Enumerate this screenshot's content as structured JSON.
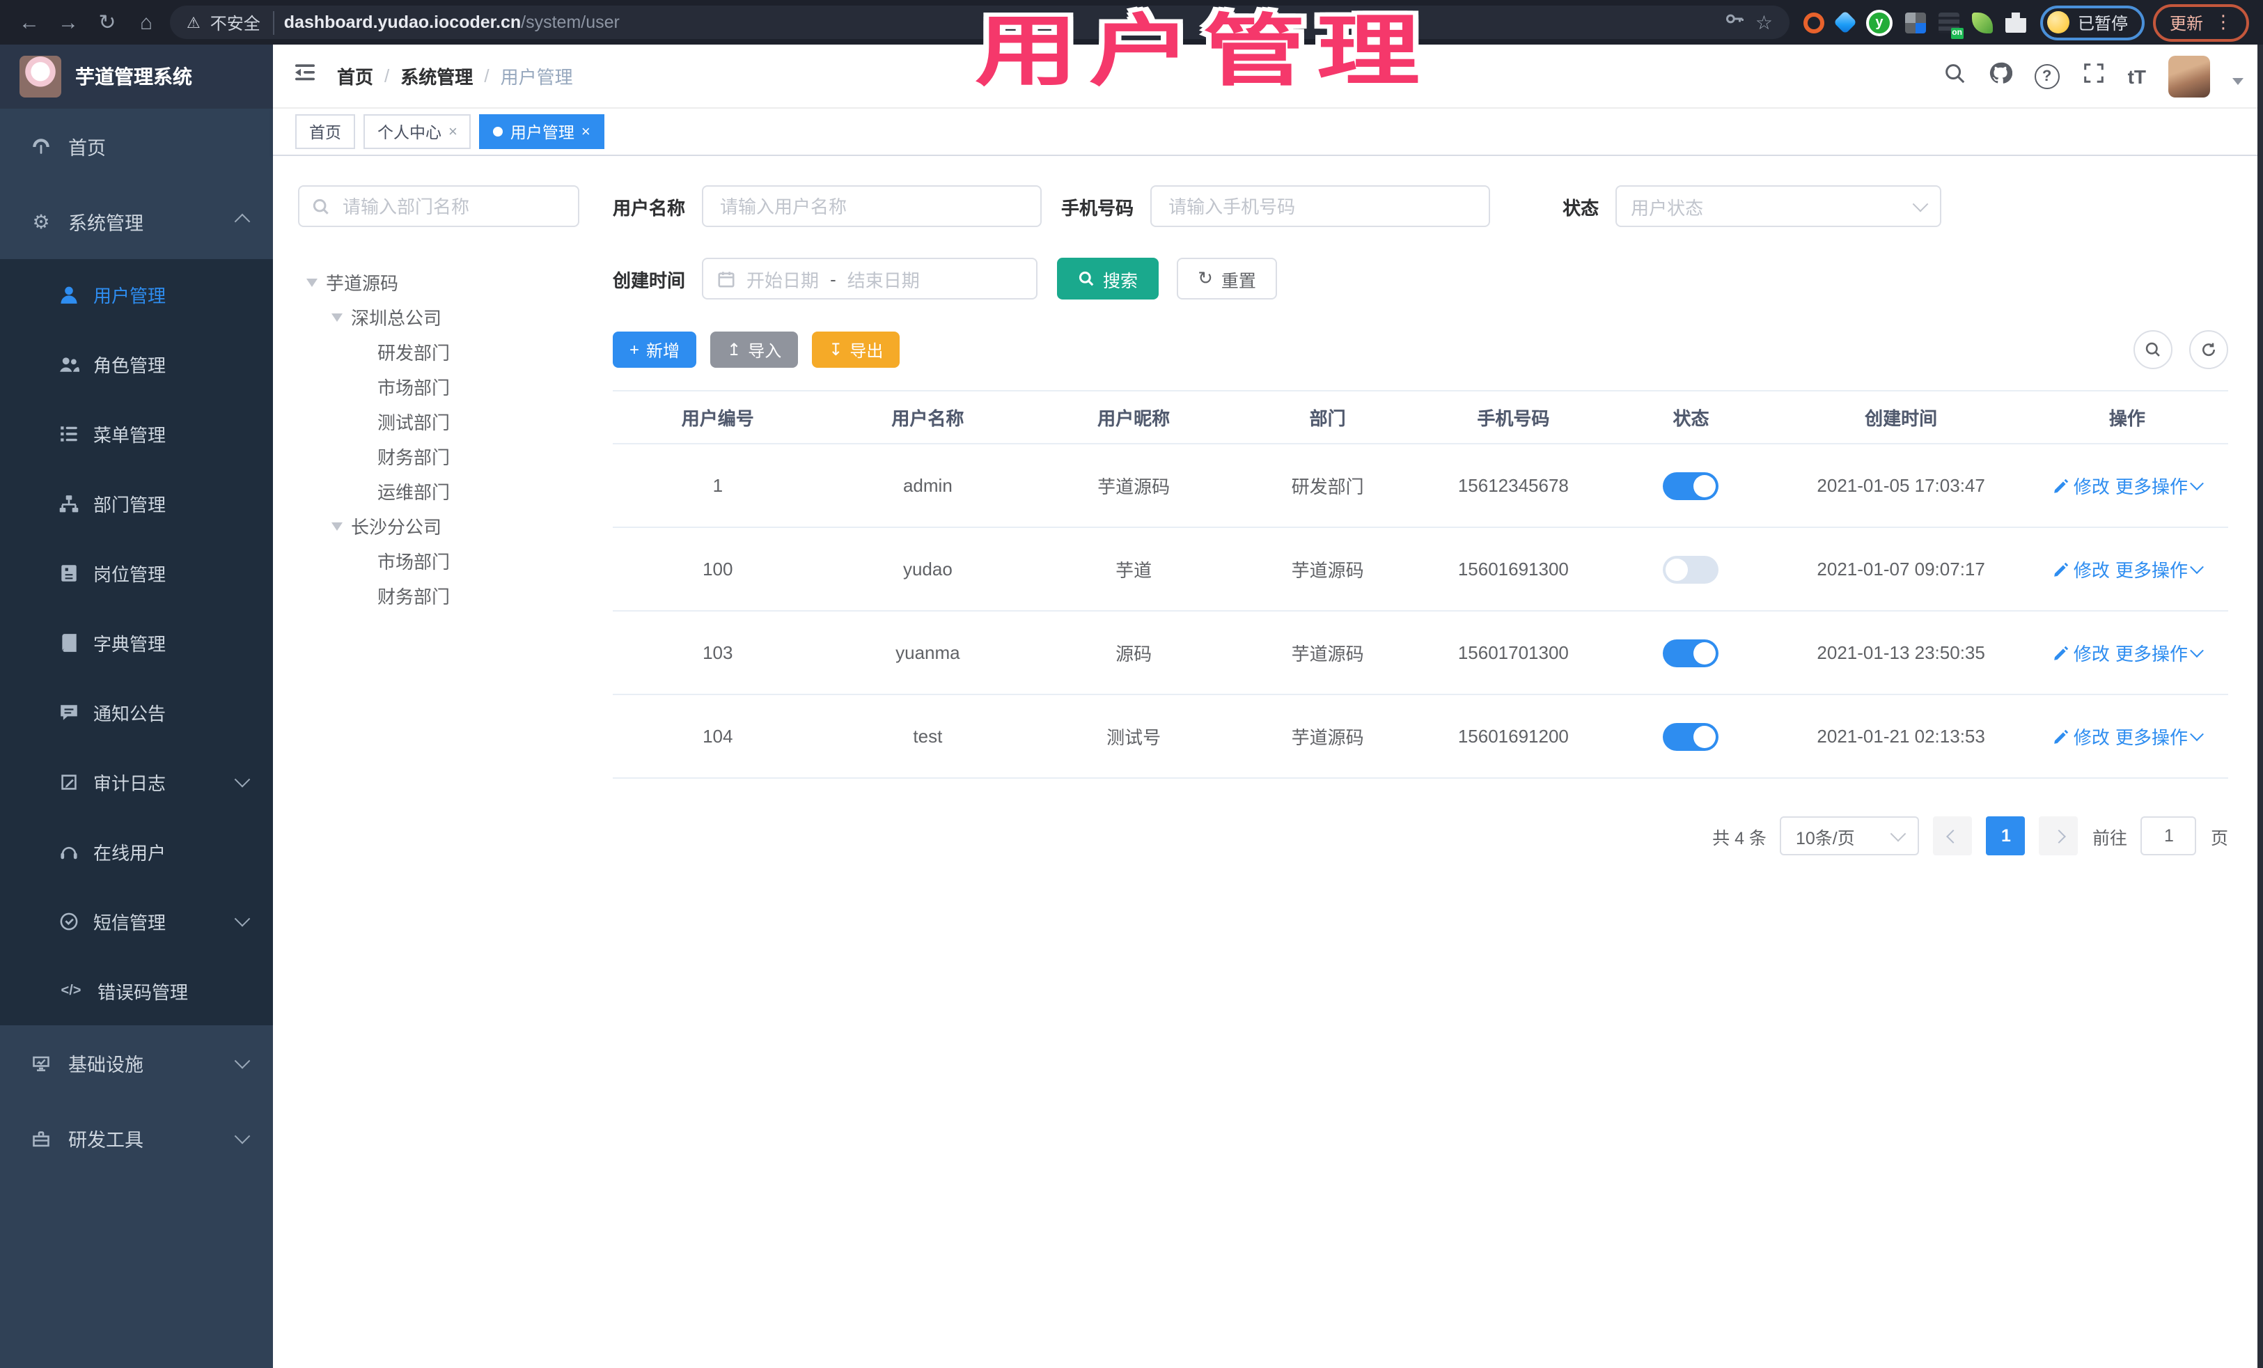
{
  "browser": {
    "security": "不安全",
    "url_host": "dashboard.yudao.iocoder.cn",
    "url_path": "/system/user",
    "paused_badge": "已暂停",
    "update_label": "更新"
  },
  "overlay_title": "用户管理",
  "icons": {
    "back": "←",
    "forward": "→",
    "reload": "↻",
    "home": "⌂",
    "warning": "⚠",
    "star": "☆",
    "kebab": "⋮",
    "gear": "⚙",
    "close": "×",
    "plus": "+",
    "upload": "↥",
    "download": "↧",
    "question": "?",
    "font_size": "tT",
    "code": "</>",
    "reset": "↻"
  },
  "app": {
    "logo_title": "芋道管理系统",
    "breadcrumb": [
      "首页",
      "系统管理",
      "用户管理"
    ],
    "breadcrumb_sep": "/",
    "tabs": [
      {
        "label": "首页"
      },
      {
        "label": "个人中心"
      },
      {
        "label": "用户管理"
      }
    ]
  },
  "sidebar": {
    "items": [
      {
        "label": "首页"
      },
      {
        "label": "系统管理"
      },
      {
        "label": "用户管理"
      },
      {
        "label": "角色管理"
      },
      {
        "label": "菜单管理"
      },
      {
        "label": "部门管理"
      },
      {
        "label": "岗位管理"
      },
      {
        "label": "字典管理"
      },
      {
        "label": "通知公告"
      },
      {
        "label": "审计日志"
      },
      {
        "label": "在线用户"
      },
      {
        "label": "短信管理"
      },
      {
        "label": "错误码管理"
      },
      {
        "label": "基础设施"
      },
      {
        "label": "研发工具"
      }
    ]
  },
  "tree": {
    "search_placeholder": "请输入部门名称",
    "nodes": [
      {
        "label": "芋道源码"
      },
      {
        "label": "深圳总公司"
      },
      {
        "label": "研发部门"
      },
      {
        "label": "市场部门"
      },
      {
        "label": "测试部门"
      },
      {
        "label": "财务部门"
      },
      {
        "label": "运维部门"
      },
      {
        "label": "长沙分公司"
      },
      {
        "label": "市场部门"
      },
      {
        "label": "财务部门"
      }
    ]
  },
  "filters": {
    "username_label": "用户名称",
    "username_placeholder": "请输入用户名称",
    "mobile_label": "手机号码",
    "mobile_placeholder": "请输入手机号码",
    "status_label": "状态",
    "status_placeholder": "用户状态",
    "created_label": "创建时间",
    "date_start_placeholder": "开始日期",
    "date_separator": "-",
    "date_end_placeholder": "结束日期",
    "search_label": "搜索",
    "reset_label": "重置"
  },
  "toolbar": {
    "add_label": "新增",
    "import_label": "导入",
    "export_label": "导出"
  },
  "table": {
    "headers": [
      "用户编号",
      "用户名称",
      "用户昵称",
      "部门",
      "手机号码",
      "状态",
      "创建时间",
      "操作"
    ],
    "edit_label": "修改",
    "more_label": "更多操作",
    "rows": [
      {
        "id": "1",
        "username": "admin",
        "nickname": "芋道源码",
        "dept": "研发部门",
        "mobile": "15612345678",
        "status": true,
        "created": "2021-01-05 17:03:47"
      },
      {
        "id": "100",
        "username": "yudao",
        "nickname": "芋道",
        "dept": "芋道源码",
        "mobile": "15601691300",
        "status": false,
        "created": "2021-01-07 09:07:17"
      },
      {
        "id": "103",
        "username": "yuanma",
        "nickname": "源码",
        "dept": "芋道源码",
        "mobile": "15601701300",
        "status": true,
        "created": "2021-01-13 23:50:35"
      },
      {
        "id": "104",
        "username": "test",
        "nickname": "测试号",
        "dept": "芋道源码",
        "mobile": "15601691200",
        "status": true,
        "created": "2021-01-21 02:13:53"
      }
    ]
  },
  "pagination": {
    "total": "共 4 条",
    "page_size": "10条/页",
    "current_page": "1",
    "goto_label": "前往",
    "goto_value": "1",
    "page_unit": "页"
  },
  "colors": {
    "accent_blue": "#2e8df0",
    "search_teal": "#1aa98d",
    "export_yellow": "#f5aa28",
    "import_gray": "#90949d",
    "sidebar_bg": "#304156",
    "submenu_bg": "#1f2d3d",
    "overlay_pink": "#f5386b"
  }
}
